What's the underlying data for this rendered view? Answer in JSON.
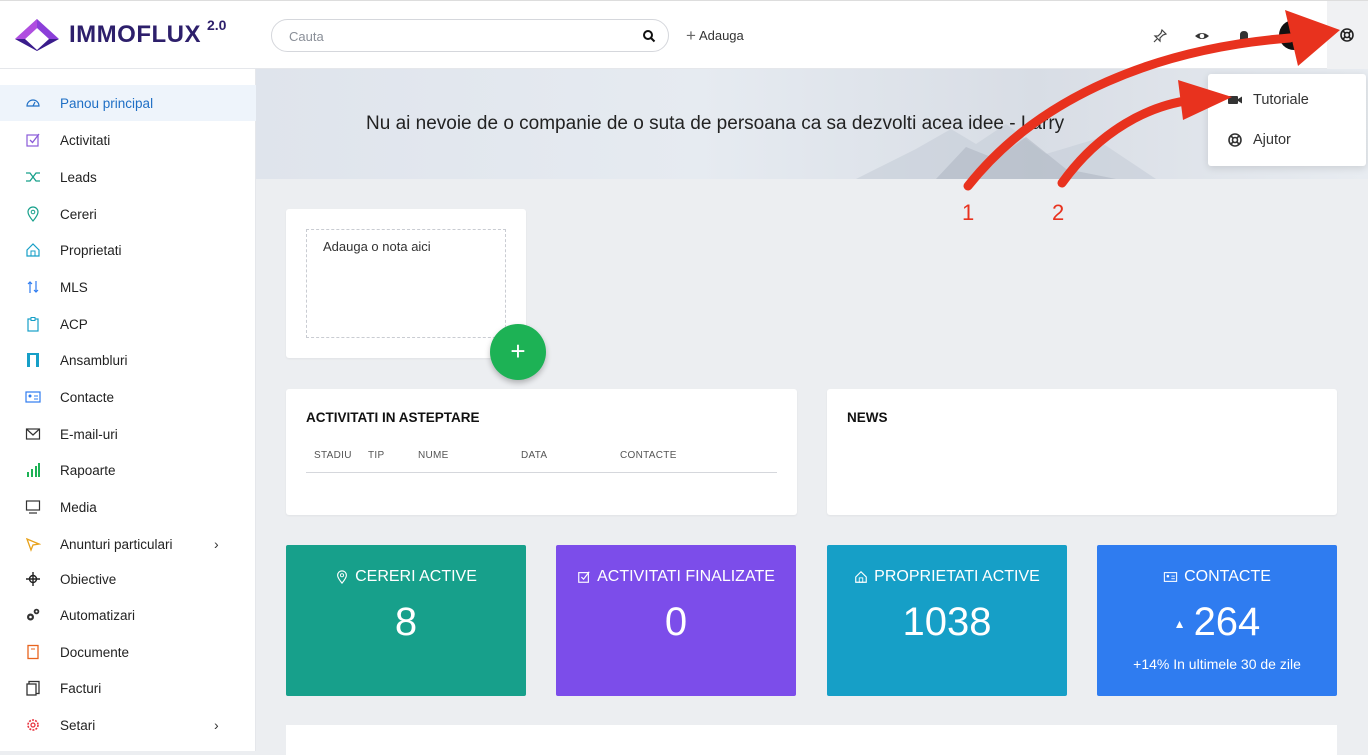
{
  "app": {
    "name": "IMMOFLUX",
    "version": "2.0"
  },
  "header": {
    "search_placeholder": "Cauta",
    "add_label": "Adauga"
  },
  "sidebar": {
    "items": [
      {
        "label": "Panou principal",
        "icon": "dashboard-icon",
        "active": true
      },
      {
        "label": "Activitati",
        "icon": "checkbox-icon"
      },
      {
        "label": "Leads",
        "icon": "shuffle-icon"
      },
      {
        "label": "Cereri",
        "icon": "map-pin-icon"
      },
      {
        "label": "Proprietati",
        "icon": "home-icon"
      },
      {
        "label": "MLS",
        "icon": "arrows-icon"
      },
      {
        "label": "ACP",
        "icon": "clipboard-icon"
      },
      {
        "label": "Ansambluri",
        "icon": "building-icon"
      },
      {
        "label": "Contacte",
        "icon": "id-card-icon"
      },
      {
        "label": "E-mail-uri",
        "icon": "envelope-icon"
      },
      {
        "label": "Rapoarte",
        "icon": "bar-chart-icon"
      },
      {
        "label": "Media",
        "icon": "monitor-icon"
      },
      {
        "label": "Anunturi particulari",
        "icon": "megaphone-icon",
        "submenu": true
      },
      {
        "label": "Obiective",
        "icon": "target-icon"
      },
      {
        "label": "Automatizari",
        "icon": "gears-icon"
      },
      {
        "label": "Documente",
        "icon": "document-icon"
      },
      {
        "label": "Facturi",
        "icon": "invoice-icon"
      },
      {
        "label": "Setari",
        "icon": "settings-icon",
        "submenu": true
      }
    ]
  },
  "banner": {
    "quote": "Nu ai nevoie de o companie de o suta de persoana ca sa dezvolti acea idee - Larry"
  },
  "note": {
    "placeholder": "Adauga o nota aici"
  },
  "pending_activities": {
    "title": "ACTIVITATI IN ASTEPTARE",
    "columns": [
      "STADIU",
      "TIP",
      "NUME",
      "DATA",
      "CONTACTE"
    ]
  },
  "news": {
    "title": "NEWS"
  },
  "stats": [
    {
      "title": "CERERI ACTIVE",
      "value": "8",
      "color": "#17a08b",
      "icon": "map-pin-icon"
    },
    {
      "title": "ACTIVITATI FINALIZATE",
      "value": "0",
      "color": "#7c4dea",
      "icon": "checkbox-icon"
    },
    {
      "title": "PROPRIETATI ACTIVE",
      "value": "1038",
      "color": "#169fc7",
      "icon": "home-icon"
    },
    {
      "title": "CONTACTE",
      "value": "264",
      "color": "#2f7cf0",
      "icon": "id-card-icon",
      "trend": "▲",
      "note": "+14% In ultimele 30 de zile"
    }
  ],
  "help_menu": {
    "items": [
      {
        "label": "Tutoriale",
        "icon": "video-camera-icon"
      },
      {
        "label": "Ajutor",
        "icon": "lifebuoy-icon"
      }
    ]
  },
  "annotations": {
    "arrow1": "1",
    "arrow2": "2",
    "color": "#e8321e"
  }
}
